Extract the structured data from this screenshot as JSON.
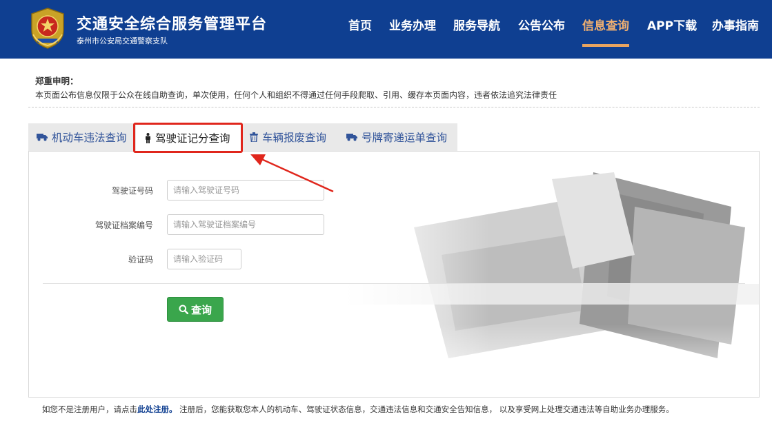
{
  "header": {
    "title": "交通安全综合服务管理平台",
    "subtitle": "泰州市公安局交通警察支队",
    "nav": [
      {
        "label": "首页",
        "active": false
      },
      {
        "label": "业务办理",
        "active": false
      },
      {
        "label": "服务导航",
        "active": false
      },
      {
        "label": "公告公布",
        "active": false
      },
      {
        "label": "信息查询",
        "active": true
      },
      {
        "label": "APP下载",
        "active": false
      },
      {
        "label": "办事指南",
        "active": false
      }
    ]
  },
  "notice": {
    "title": "郑重申明：",
    "text": "本页面公布信息仅限于公众在线自助查询，单次使用，任何个人和组织不得通过任何手段爬取、引用、缓存本页面内容，违者依法追究法律责任"
  },
  "tabs": [
    {
      "label": "机动车违法查询",
      "icon": "truck-icon"
    },
    {
      "label": "驾驶证记分查询",
      "icon": "person-icon",
      "active": true
    },
    {
      "label": "车辆报废查询",
      "icon": "trash-icon"
    },
    {
      "label": "号牌寄递运单查询",
      "icon": "truck-icon"
    }
  ],
  "form": {
    "license_label": "驾驶证号码",
    "license_placeholder": "请输入驾驶证号码",
    "file_label": "驾驶证档案编号",
    "file_placeholder": "请输入驾驶证档案编号",
    "captcha_label": "验证码",
    "captcha_placeholder": "请输入验证码",
    "search_label": "查询"
  },
  "footer": {
    "prefix": "如您不是注册用户，请点击",
    "link": "此处注册。",
    "suffix": " 注册后，您能获取您本人的机动车、驾驶证状态信息，交通违法信息和交通安全告知信息， 以及享受网上处理交通违法等自助业务办理服务。"
  },
  "colors": {
    "header_bg": "#0f3f91",
    "nav_active": "#f0b070",
    "accent_green": "#3aa64c",
    "highlight_red": "#e0261c"
  }
}
